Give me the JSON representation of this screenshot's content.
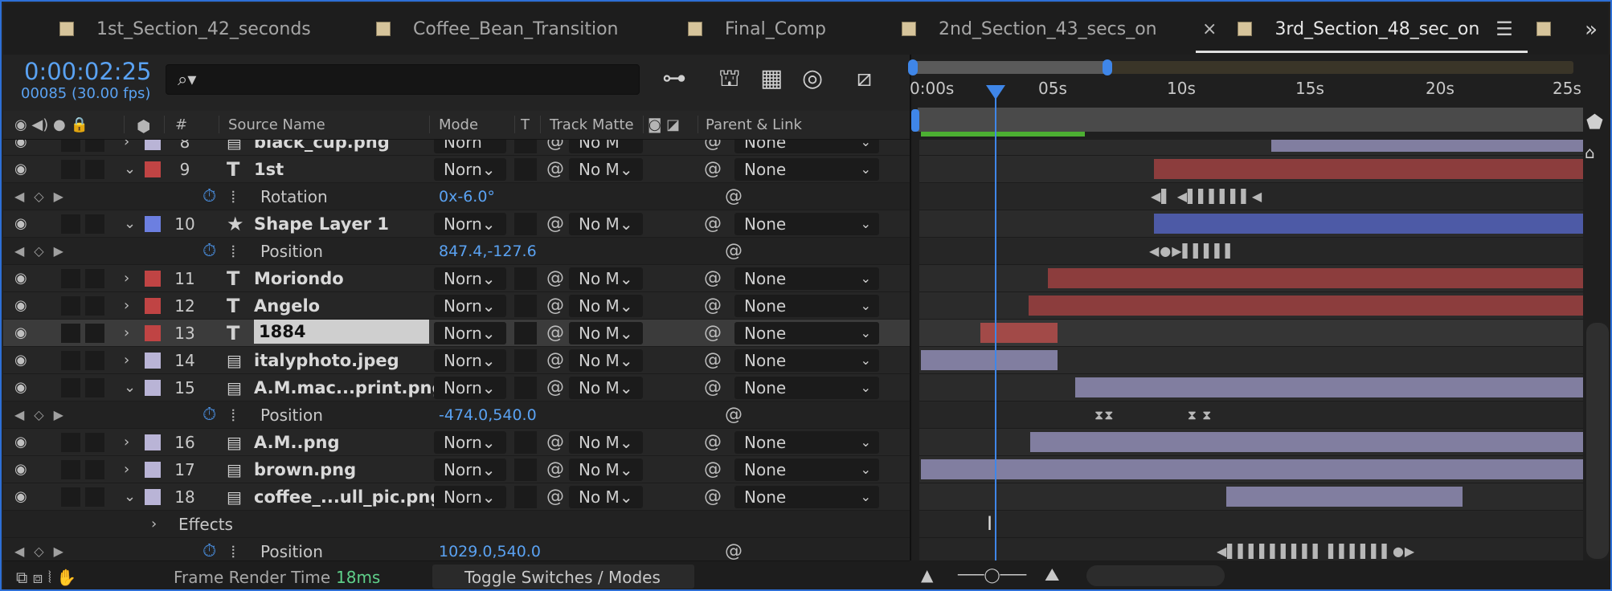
{
  "tabs": [
    {
      "label": "1st_Section_42_seconds"
    },
    {
      "label": "Coffee_Bean_Transition"
    },
    {
      "label": "Final_Comp"
    },
    {
      "label": "2nd_Section_43_secs_on"
    },
    {
      "label": "3rd_Section_48_sec_on"
    }
  ],
  "tab_close": "×",
  "tab_menu": "☰",
  "overflow": "»",
  "timecode": "0:00:02:25",
  "frames": "00085 (30.00 fps)",
  "columns": {
    "num": "#",
    "source": "Source Name",
    "mode": "Mode",
    "t": "T",
    "matte": "Track Matte",
    "parent": "Parent & Link"
  },
  "layers": [
    {
      "num": "8",
      "name": "black_cup.png",
      "color": "#b9b4d6",
      "mode": "Norn",
      "matte": "No M",
      "parent": "None",
      "kind": "file"
    },
    {
      "num": "9",
      "name": "1st",
      "color": "#c04444",
      "mode": "Norn",
      "matte": "No M",
      "parent": "None",
      "kind": "text",
      "prop": {
        "name": "Rotation",
        "value": "0x-6.0°"
      }
    },
    {
      "num": "10",
      "name": "Shape Layer 1",
      "color": "#6c7fe0",
      "mode": "Norn",
      "matte": "No M",
      "parent": "None",
      "kind": "shape",
      "prop": {
        "name": "Position",
        "value": "847.4,-127.6"
      }
    },
    {
      "num": "11",
      "name": "Moriondo",
      "color": "#c04444",
      "mode": "Norn",
      "matte": "No M",
      "parent": "None",
      "kind": "text"
    },
    {
      "num": "12",
      "name": "Angelo",
      "color": "#c04444",
      "mode": "Norn",
      "matte": "No M",
      "parent": "None",
      "kind": "text"
    },
    {
      "num": "13",
      "name": "1884",
      "color": "#c04444",
      "mode": "Norn",
      "matte": "No M",
      "parent": "None",
      "kind": "text",
      "selected": true
    },
    {
      "num": "14",
      "name": "italyphoto.jpeg",
      "color": "#b9b4d6",
      "mode": "Norn",
      "matte": "No M",
      "parent": "None",
      "kind": "file"
    },
    {
      "num": "15",
      "name": "A.M.mac...print.png",
      "color": "#b9b4d6",
      "mode": "Norn",
      "matte": "No M",
      "parent": "None",
      "kind": "file",
      "prop": {
        "name": "Position",
        "value": "-474.0,540.0"
      }
    },
    {
      "num": "16",
      "name": "A.M..png",
      "color": "#b9b4d6",
      "mode": "Norn",
      "matte": "No M",
      "parent": "None",
      "kind": "file"
    },
    {
      "num": "17",
      "name": "brown.png",
      "color": "#b9b4d6",
      "mode": "Norn",
      "matte": "No M",
      "parent": "None",
      "kind": "file"
    },
    {
      "num": "18",
      "name": "coffee_...ull_pic.png",
      "color": "#b9b4d6",
      "mode": "Norn",
      "matte": "No M",
      "parent": "None",
      "kind": "file"
    }
  ],
  "effects_label": "Effects",
  "last_prop": {
    "name": "Position",
    "value": "1029.0,540.0"
  },
  "bottom": {
    "render_label": "Frame Render Time",
    "render_value": "18ms",
    "toggle": "Toggle Switches / Modes"
  },
  "ruler": [
    "0:00s",
    "05s",
    "10s",
    "15s",
    "20s",
    "25s"
  ]
}
